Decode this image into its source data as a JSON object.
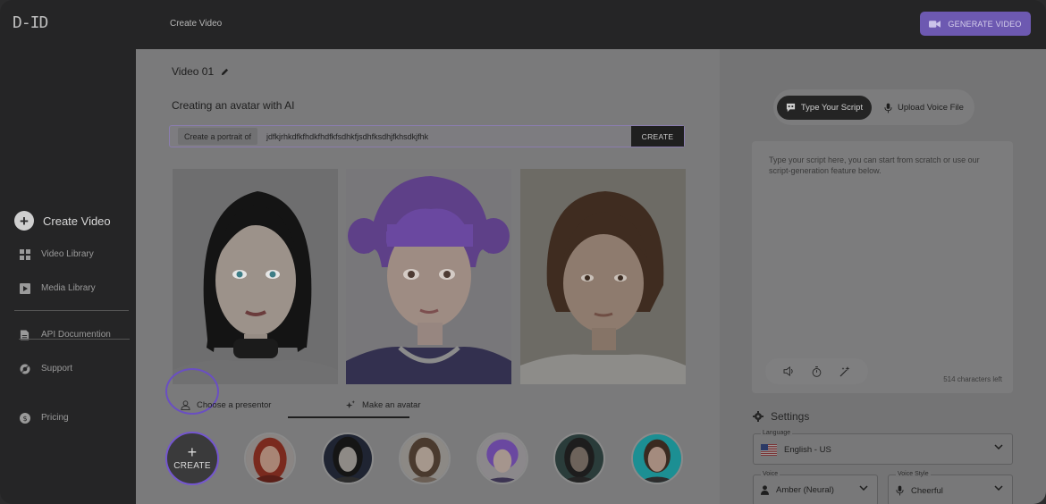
{
  "app": {
    "logo": "D-ID",
    "breadcrumb": "Create Video",
    "generate_button": "GENERATE VIDEO"
  },
  "sidebar": {
    "create": "Create Video",
    "items": [
      {
        "label": "Video Library",
        "icon": "grid-icon"
      },
      {
        "label": "Media Library",
        "icon": "play-icon"
      },
      {
        "label": "API Documention",
        "icon": "document-icon"
      },
      {
        "label": "Support",
        "icon": "lifebuoy-icon"
      },
      {
        "label": "Pricing",
        "icon": "dollar-icon"
      }
    ]
  },
  "main": {
    "video_title": "Video 01",
    "section_title": "Creating an avatar with AI",
    "prompt": {
      "prefix": "Create a portrait of",
      "value": "jdfkjrhkdfkfhdkfhdfkfsdhkfjsdhfksdhjfkhsdkjfhk",
      "create_label": "CREATE"
    },
    "tabs": [
      {
        "label": "Choose a presentor",
        "icon": "person-icon"
      },
      {
        "label": "Make an avatar",
        "icon": "sparkle-icon"
      }
    ],
    "create_thumb_label": "CREATE"
  },
  "script_panel": {
    "toggle": {
      "type_script": "Type Your Script",
      "upload_voice": "Upload Voice File"
    },
    "placeholder": "Type your script here, you can start from scratch or use our script-generation feature below.",
    "chars_left": "514 characters left"
  },
  "settings": {
    "title": "Settings",
    "language": {
      "label": "Language",
      "value": "English - US"
    },
    "voice": {
      "label": "Voice",
      "value": "Amber (Neural)"
    },
    "voice_style": {
      "label": "Voice Style",
      "value": "Cheerful"
    }
  },
  "colors": {
    "accent": "#6d59b1",
    "ring": "#6a4fc2",
    "dark": "#252526"
  }
}
